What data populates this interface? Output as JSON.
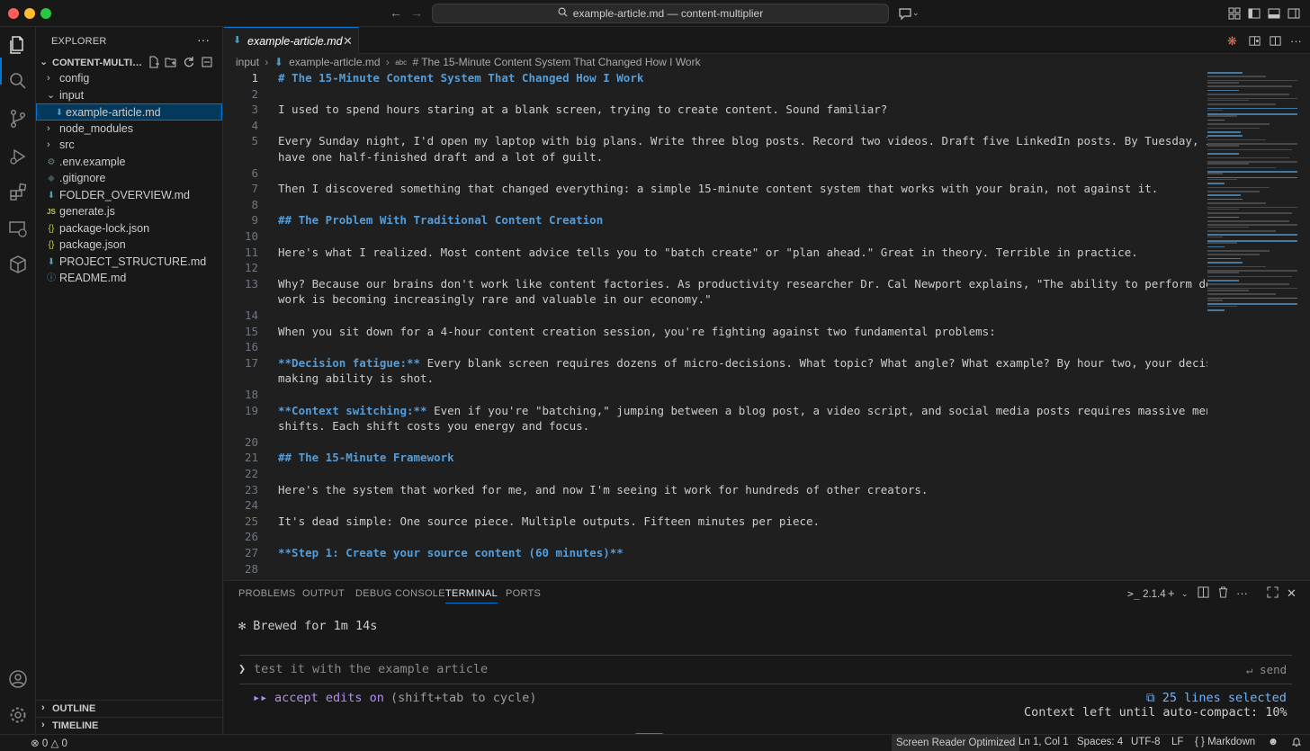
{
  "window": {
    "search_text": "example-article.md — content-multiplier"
  },
  "explorer": {
    "title": "EXPLORER",
    "more": "···",
    "folder_name": "CONTENT-MULTIPL...",
    "items": [
      {
        "label": "config",
        "type": "folder",
        "expanded": false
      },
      {
        "label": "input",
        "type": "folder",
        "expanded": true
      },
      {
        "label": "example-article.md",
        "type": "md",
        "selected": true
      },
      {
        "label": "node_modules",
        "type": "folder",
        "expanded": false
      },
      {
        "label": "src",
        "type": "folder",
        "expanded": false
      },
      {
        "label": ".env.example",
        "type": "gear"
      },
      {
        "label": ".gitignore",
        "type": "git"
      },
      {
        "label": "FOLDER_OVERVIEW.md",
        "type": "md"
      },
      {
        "label": "generate.js",
        "type": "js"
      },
      {
        "label": "package-lock.json",
        "type": "json"
      },
      {
        "label": "package.json",
        "type": "json"
      },
      {
        "label": "PROJECT_STRUCTURE.md",
        "type": "md"
      },
      {
        "label": "README.md",
        "type": "info"
      }
    ],
    "outline": "OUTLINE",
    "timeline": "TIMELINE"
  },
  "editor": {
    "tab_label": "example-article.md",
    "breadcrumb": [
      "input",
      "example-article.md",
      "# The 15-Minute Content System That Changed How I Work"
    ],
    "breadcrumb_abc": "abc",
    "lines": [
      {
        "n": "1",
        "segs": [
          {
            "t": "# The 15-Minute Content System That Changed How I Work",
            "c": "h"
          }
        ]
      },
      {
        "n": "2",
        "segs": []
      },
      {
        "n": "3",
        "segs": [
          {
            "t": "I used to spend hours staring at a blank screen, trying to create content. Sound familiar?"
          }
        ]
      },
      {
        "n": "4",
        "segs": []
      },
      {
        "n": "5",
        "segs": [
          {
            "t": "Every Sunday night, I'd open my laptop with big plans. Write three blog posts. Record two videos. Draft five LinkedIn posts. By Tuesday, I'd"
          }
        ]
      },
      {
        "n": "",
        "segs": [
          {
            "t": "have one half-finished draft and a lot of guilt."
          }
        ]
      },
      {
        "n": "6",
        "segs": []
      },
      {
        "n": "7",
        "segs": [
          {
            "t": "Then I discovered something that changed everything: a simple 15-minute content system that works with your brain, not against it."
          }
        ]
      },
      {
        "n": "8",
        "segs": []
      },
      {
        "n": "9",
        "segs": [
          {
            "t": "## The Problem With Traditional Content Creation",
            "c": "h"
          }
        ]
      },
      {
        "n": "10",
        "segs": []
      },
      {
        "n": "11",
        "segs": [
          {
            "t": "Here's what I realized. Most content advice tells you to \"batch create\" or \"plan ahead.\" Great in theory. Terrible in practice."
          }
        ]
      },
      {
        "n": "12",
        "segs": []
      },
      {
        "n": "13",
        "segs": [
          {
            "t": "Why? Because our brains don't work like content factories. As productivity researcher Dr. Cal Newport explains, \"The ability to perform deep"
          }
        ]
      },
      {
        "n": "",
        "segs": [
          {
            "t": "work is becoming increasingly rare and valuable in our economy.\""
          }
        ]
      },
      {
        "n": "14",
        "segs": []
      },
      {
        "n": "15",
        "segs": [
          {
            "t": "When you sit down for a 4-hour content creation session, you're fighting against two fundamental problems:"
          }
        ]
      },
      {
        "n": "16",
        "segs": []
      },
      {
        "n": "17",
        "segs": [
          {
            "t": "**Decision fatigue:**",
            "c": "b"
          },
          {
            "t": " Every blank screen requires dozens of micro-decisions. What topic? What angle? What example? By hour two, your decision-"
          }
        ]
      },
      {
        "n": "",
        "segs": [
          {
            "t": "making ability is shot."
          }
        ]
      },
      {
        "n": "18",
        "segs": []
      },
      {
        "n": "19",
        "segs": [
          {
            "t": "**Context switching:**",
            "c": "b"
          },
          {
            "t": " Even if you're \"batching,\" jumping between a blog post, a video script, and social media posts requires massive mental"
          }
        ]
      },
      {
        "n": "",
        "segs": [
          {
            "t": "shifts. Each shift costs you energy and focus."
          }
        ]
      },
      {
        "n": "20",
        "segs": []
      },
      {
        "n": "21",
        "segs": [
          {
            "t": "## The 15-Minute Framework",
            "c": "h"
          }
        ]
      },
      {
        "n": "22",
        "segs": []
      },
      {
        "n": "23",
        "segs": [
          {
            "t": "Here's the system that worked for me, and now I'm seeing it work for hundreds of other creators."
          }
        ]
      },
      {
        "n": "24",
        "segs": []
      },
      {
        "n": "25",
        "segs": [
          {
            "t": "It's dead simple: One source piece. Multiple outputs. Fifteen minutes per piece."
          }
        ]
      },
      {
        "n": "26",
        "segs": []
      },
      {
        "n": "27",
        "segs": [
          {
            "t": "**Step 1: Create your source content (60 minutes)**",
            "c": "b"
          }
        ]
      },
      {
        "n": "28",
        "segs": []
      }
    ]
  },
  "panel": {
    "tabs": [
      "PROBLEMS",
      "OUTPUT",
      "DEBUG CONSOLE",
      "TERMINAL",
      "PORTS"
    ],
    "active_tab": "TERMINAL",
    "terminal_label": "2.1.4",
    "brewed": "✻ Brewed for 1m 14s",
    "prompt_symbol": "❯",
    "prompt_text": "test it with the example article",
    "send_label": "↵ send",
    "mode_arrows": "▸▸",
    "mode_label": "accept edits on",
    "mode_hint": "(shift+tab to cycle)",
    "selection_info": "⧉ 25 lines selected",
    "context_info": "Context left until auto-compact: 10%"
  },
  "status": {
    "errors": "0",
    "warnings": "0",
    "screen_reader": "Screen Reader Optimized",
    "position": "Ln 1, Col 1",
    "spaces": "Spaces: 4",
    "encoding": "UTF-8",
    "eol": "LF",
    "language": "Markdown",
    "language_braces": "{ }"
  },
  "colors": {
    "accent": "#0078d4",
    "heading": "#569cd6",
    "terminal_purple": "#b48ef0",
    "terminal_link": "#6cb6ff"
  }
}
